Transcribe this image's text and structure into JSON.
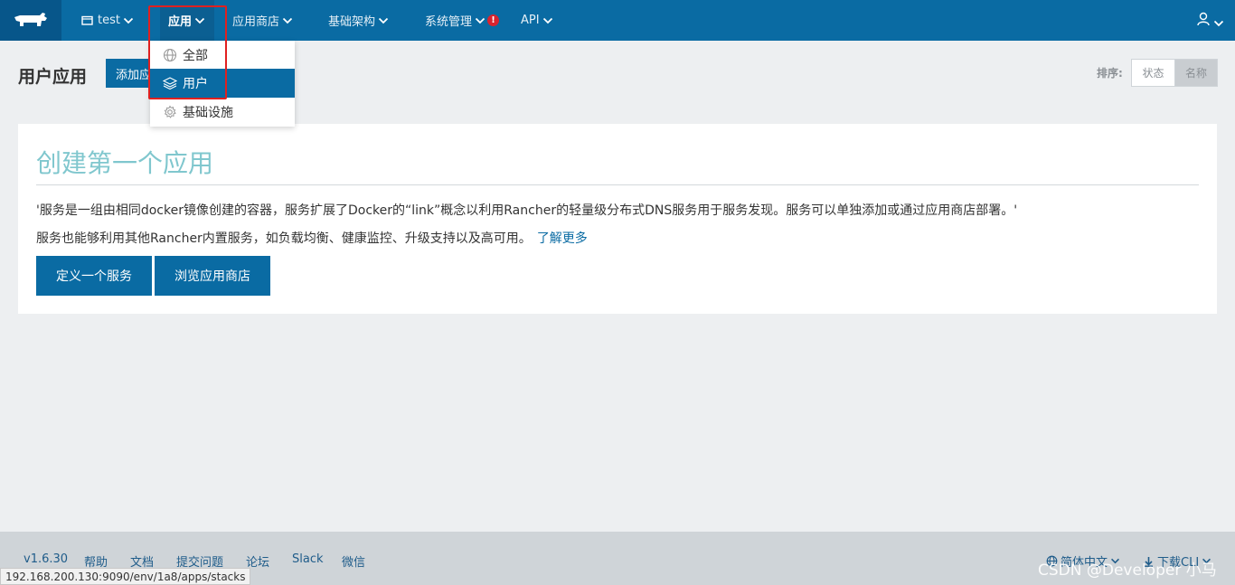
{
  "nav": {
    "env": "test",
    "items": [
      {
        "label": "应用",
        "active": true
      },
      {
        "label": "应用商店"
      },
      {
        "label": "基础架构"
      },
      {
        "label": "系统管理",
        "alert": "!"
      },
      {
        "label": "API"
      }
    ]
  },
  "dropdown": {
    "items": [
      {
        "label": "全部",
        "icon": "globe-icon"
      },
      {
        "label": "用户",
        "icon": "layers-icon",
        "selected": true
      },
      {
        "label": "基础设施",
        "icon": "gear-icon"
      }
    ]
  },
  "page": {
    "title": "用户应用",
    "add_label": "添加应用",
    "sort_label": "排序:",
    "sort_options": [
      "状态",
      "名称"
    ],
    "sort_selected": "名称"
  },
  "card": {
    "title": "创建第一个应用",
    "text1": "'服务是一组由相同docker镜像创建的容器，服务扩展了Docker的“link”概念以利用Rancher的轻量级分布式DNS服务用于服务发现。服务可以单独添加或通过应用商店部署。'",
    "text2": "服务也能够利用其他Rancher内置服务，如负载均衡、健康监控、升级支持以及高可用。",
    "learn_more": "了解更多",
    "btn_define": "定义一个服务",
    "btn_browse": "浏览应用商店"
  },
  "footer": {
    "links": [
      "v1.6.30",
      "帮助",
      "文档",
      "提交问题",
      "论坛",
      "Slack",
      "微信"
    ],
    "language": "简体中文",
    "download": "下载CLI"
  },
  "status_url": "192.168.200.130:9090/env/1a8/apps/stacks",
  "watermark": "CSDN @Developer 小马",
  "colors": {
    "nav_bg": "#0a6ba3",
    "accent": "#0a6ba3",
    "title_teal": "#80c7ce",
    "highlight": "#e02020"
  }
}
